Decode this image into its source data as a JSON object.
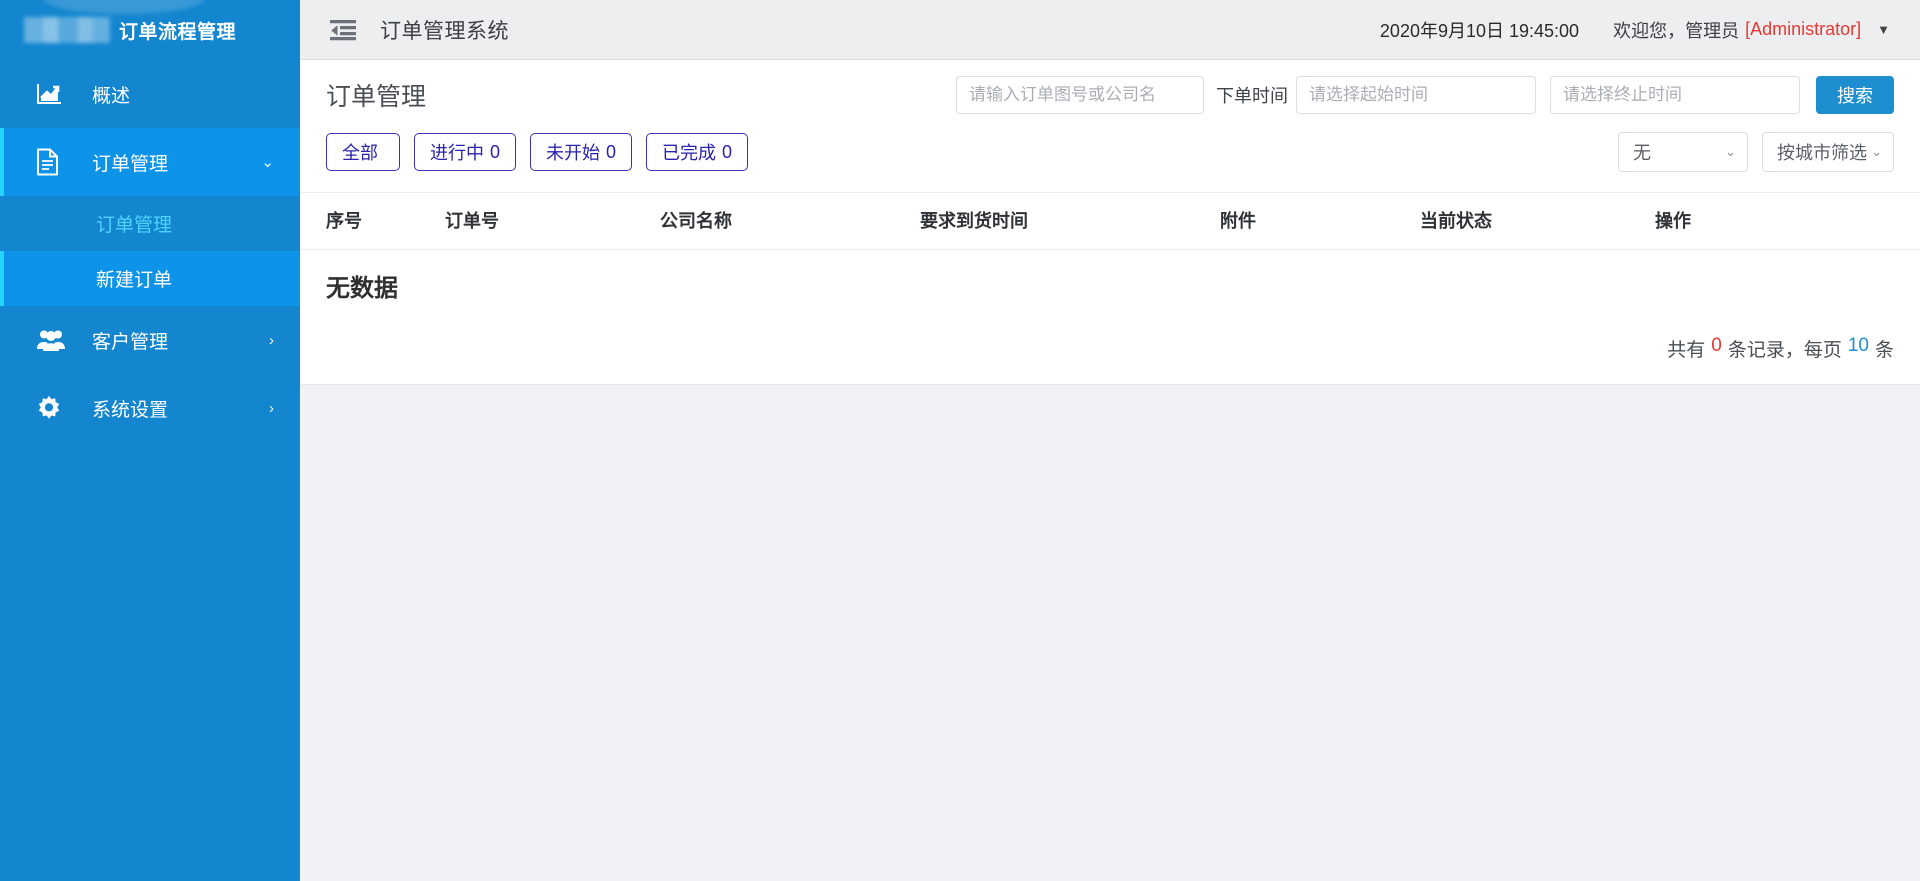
{
  "sidebar": {
    "logo": {
      "text": "订单流程管理",
      "icon": "blurred-logo-mark"
    },
    "items": [
      {
        "label": "概述",
        "icon": "chart-line-icon",
        "arrow": "",
        "state": "normal"
      },
      {
        "label": "订单管理",
        "icon": "document-icon",
        "arrow": "⌄",
        "state": "open"
      },
      {
        "label": "客户管理",
        "icon": "users-icon",
        "arrow": "›",
        "state": "normal"
      },
      {
        "label": "系统设置",
        "icon": "gear-icon",
        "arrow": "›",
        "state": "normal"
      }
    ],
    "submenu": [
      {
        "label": "订单管理",
        "state": "active"
      },
      {
        "label": "新建订单",
        "state": "hovered"
      }
    ]
  },
  "topbar": {
    "collapse_icon": "collapse-menu-icon",
    "title": "订单管理系统",
    "datetime": "2020年9月10日 19:45:00",
    "welcome_prefix": "欢迎您，管理员",
    "admin_name": "[Administrator]",
    "caret_icon": "chevron-down-icon"
  },
  "page": {
    "title": "订单管理",
    "search": {
      "keyword_placeholder": "请输入订单图号或公司名",
      "keyword_value": "",
      "date_label": "下单时间",
      "start_placeholder": "请选择起始时间",
      "start_value": "",
      "end_placeholder": "请选择终止时间",
      "end_value": "",
      "button_label": "搜索"
    },
    "filters": [
      {
        "label": "全部",
        "count": ""
      },
      {
        "label": "进行中",
        "count": "0"
      },
      {
        "label": "未开始",
        "count": "0"
      },
      {
        "label": "已完成",
        "count": "0"
      }
    ],
    "selects": [
      {
        "value": "无",
        "caret": "⌄"
      },
      {
        "value": "按城市筛选",
        "caret": "⌄"
      }
    ],
    "table": {
      "columns": [
        "序号",
        "订单号",
        "公司名称",
        "要求到货时间",
        "附件",
        "当前状态",
        "操作"
      ],
      "rows": [],
      "empty_text": "无数据"
    },
    "pagination": {
      "prefix": "共有",
      "total": "0",
      "middle": "条记录，每页",
      "page_size": "10",
      "suffix": "条"
    }
  },
  "colors": {
    "sidebar_bg": "#1386cf",
    "sidebar_active": "#0d93e8",
    "accent_cyan": "#4fd2ff",
    "primary_blue": "#1d8fd1",
    "chip_blue": "#2a22ad",
    "danger_red": "#e53935"
  }
}
